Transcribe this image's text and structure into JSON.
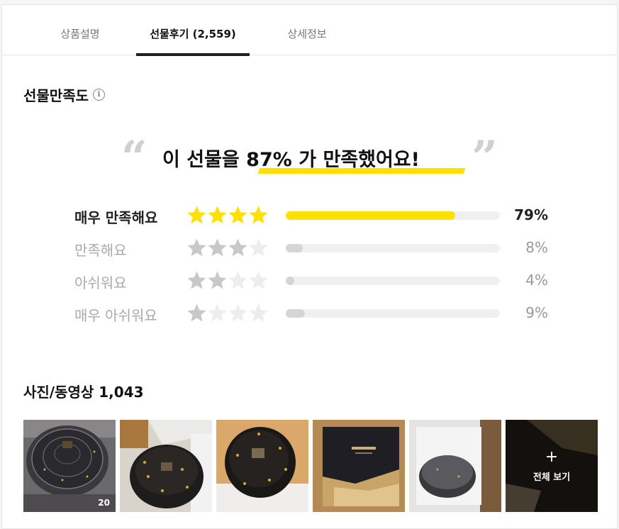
{
  "tabs": [
    {
      "label": "상품설명",
      "active": false
    },
    {
      "label": "선물후기 (2,559)",
      "active": true
    },
    {
      "label": "상세정보",
      "active": false
    }
  ],
  "satisfaction": {
    "title": "선물만족도",
    "headline_prefix": "이 선물을 ",
    "headline_percent": "87% 가",
    "headline_suffix": " 만족했어요!",
    "rows": [
      {
        "label": "매우 만족해요",
        "stars": 4,
        "fraction": 0.79,
        "percent": "79%"
      },
      {
        "label": "만족해요",
        "stars": 3,
        "fraction": 0.08,
        "percent": "8%"
      },
      {
        "label": "아쉬워요",
        "stars": 2,
        "fraction": 0.04,
        "percent": "4%"
      },
      {
        "label": "매우 아쉬워요",
        "stars": 1,
        "fraction": 0.09,
        "percent": "9%"
      }
    ]
  },
  "media": {
    "title": "사진/동영상 1,043",
    "first_count": "20",
    "more_label": "전체 보기"
  },
  "colors": {
    "accent": "#ffe000",
    "star_on_first": "#ffe000",
    "star_on": "#c8c8c8",
    "star_off": "#ededed"
  }
}
